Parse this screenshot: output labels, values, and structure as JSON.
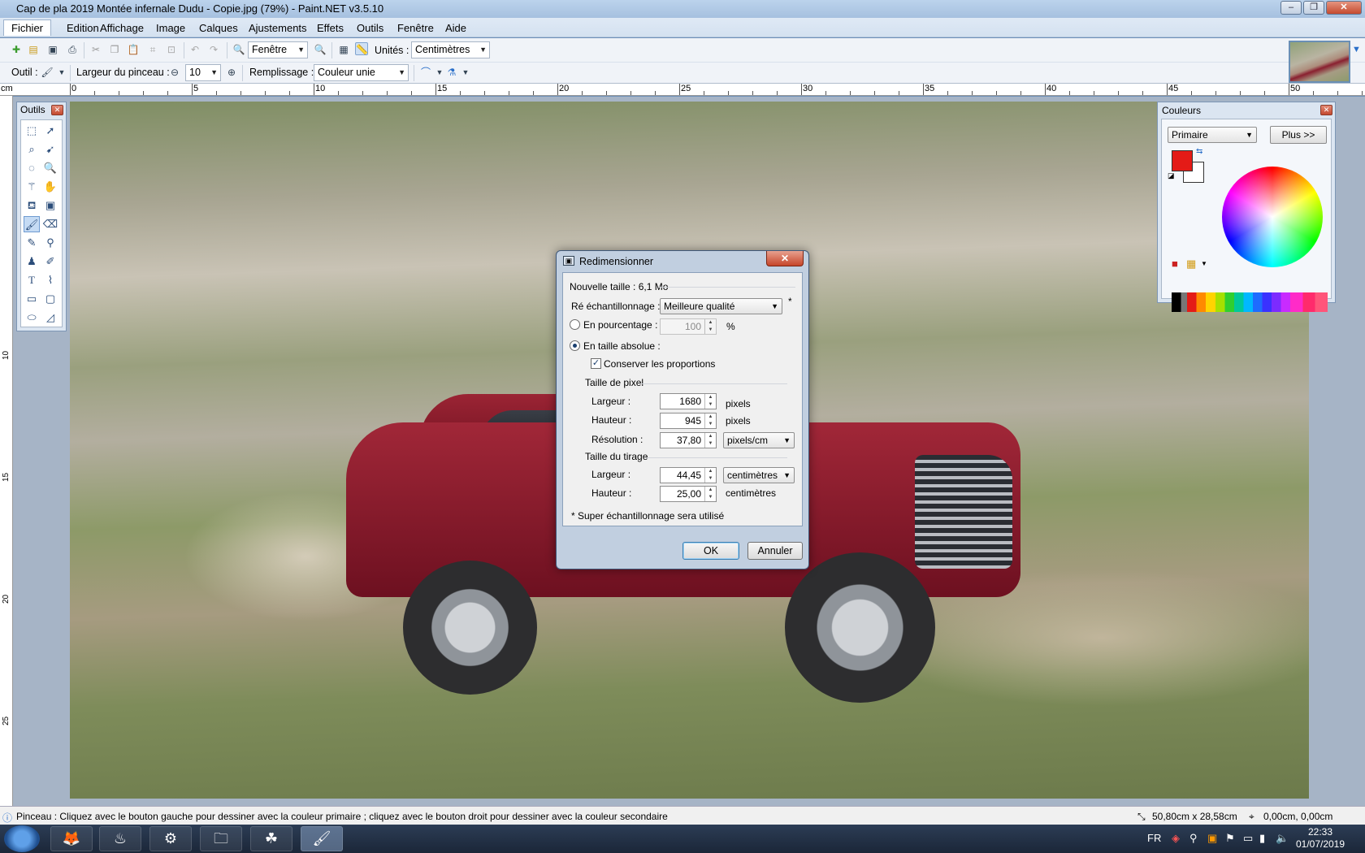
{
  "window": {
    "title": "Cap de pla 2019 Montée infernale Dudu - Copie.jpg (79%) - Paint.NET v3.5.10",
    "min": "–",
    "max": "❐",
    "close": "✕"
  },
  "menu": [
    "Fichier",
    "Edition",
    "Affichage",
    "Image",
    "Calques",
    "Ajustements",
    "Effets",
    "Outils",
    "Fenêtre",
    "Aide"
  ],
  "toolbar": {
    "zoom_value": "Fenêtre",
    "units_label": "Unités :",
    "units_value": "Centimètres"
  },
  "toolbar2": {
    "tool_label": "Outil :",
    "brush_width_label": "Largeur du pinceau :",
    "brush_width_value": "10",
    "fill_label": "Remplissage :",
    "fill_value": "Couleur unie"
  },
  "ruler": {
    "unit": "cm",
    "top_marks": [
      "0",
      "5",
      "10",
      "15",
      "20",
      "25",
      "30",
      "35",
      "40",
      "45",
      "50"
    ],
    "left_marks": [
      "10",
      "15",
      "20",
      "25"
    ]
  },
  "tools_palette": {
    "title": "Outils"
  },
  "colors_palette": {
    "title": "Couleurs",
    "mode": "Primaire",
    "more_button": "Plus >>",
    "primary_color": "#e41b17",
    "secondary_color": "#ffffff"
  },
  "dialog": {
    "title": "Redimensionner",
    "new_size": "Nouvelle taille : 6,1 Mo",
    "resampling_label": "Ré échantillonnage :",
    "resampling_value": "Meilleure qualité",
    "resampling_note": "*",
    "by_percentage_label": "En pourcentage :",
    "percentage_value": "100",
    "percent_symbol": "%",
    "by_absolute_label": "En taille absolue :",
    "keep_ratio_label": "Conserver les proportions",
    "pixel_size_label": "Taille de pixel",
    "pixel_width_label": "Largeur :",
    "pixel_width_value": "1680",
    "pixel_height_label": "Hauteur :",
    "pixel_height_value": "945",
    "pixels_unit": "pixels",
    "resolution_label": "Résolution :",
    "resolution_value": "37,80",
    "resolution_unit": "pixels/cm",
    "print_size_label": "Taille du tirage",
    "print_width_label": "Largeur :",
    "print_width_value": "44,45",
    "print_height_label": "Hauteur :",
    "print_height_value": "25,00",
    "print_unit": "centimètres",
    "footnote": "* Super échantillonnage sera utilisé",
    "ok": "OK",
    "cancel": "Annuler"
  },
  "status": {
    "hint": "Pinceau : Cliquez avec le bouton gauche pour dessiner avec la couleur primaire ; cliquez avec le bouton droit pour dessiner avec la couleur secondaire",
    "image_size": "50,80cm x 28,58cm",
    "cursor_pos": "0,00cm, 0,00cm"
  },
  "taskbar": {
    "language": "FR",
    "time": "22:33",
    "date": "01/07/2019"
  }
}
